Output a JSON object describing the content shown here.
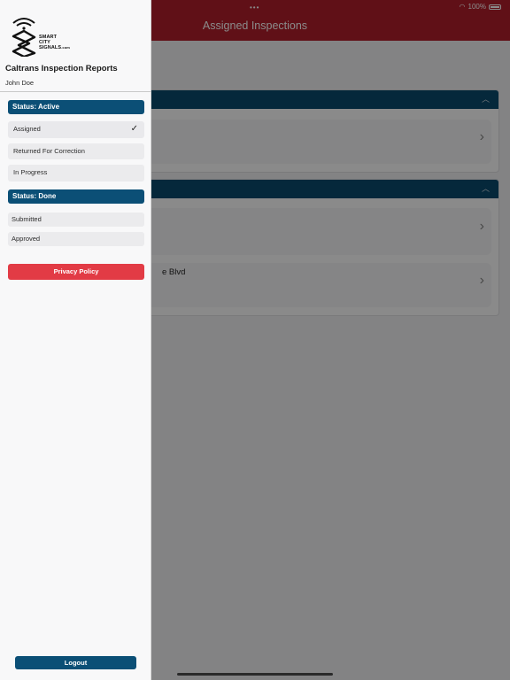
{
  "status_bar": {
    "battery": "100%"
  },
  "background": {
    "title": "Assigned Inspections",
    "partial_address": "e Blvd"
  },
  "drawer": {
    "logo_text": [
      "SMART",
      "CITY",
      "SIGNALS",
      ".com"
    ],
    "app_title": "Caltrans Inspection Reports",
    "user_name": "John Doe",
    "groups": [
      {
        "title": "Status: Active",
        "items": [
          "Assigned",
          "Returned For Correction",
          "In Progress"
        ],
        "selected": "Assigned"
      },
      {
        "title": "Status: Done",
        "items": [
          "Submitted",
          "Approved"
        ]
      }
    ],
    "privacy_label": "Privacy Policy",
    "logout_label": "Logout"
  },
  "colors": {
    "header_red": "#b21f2b",
    "navy": "#0b4f76",
    "privacy_red": "#e23b45"
  }
}
